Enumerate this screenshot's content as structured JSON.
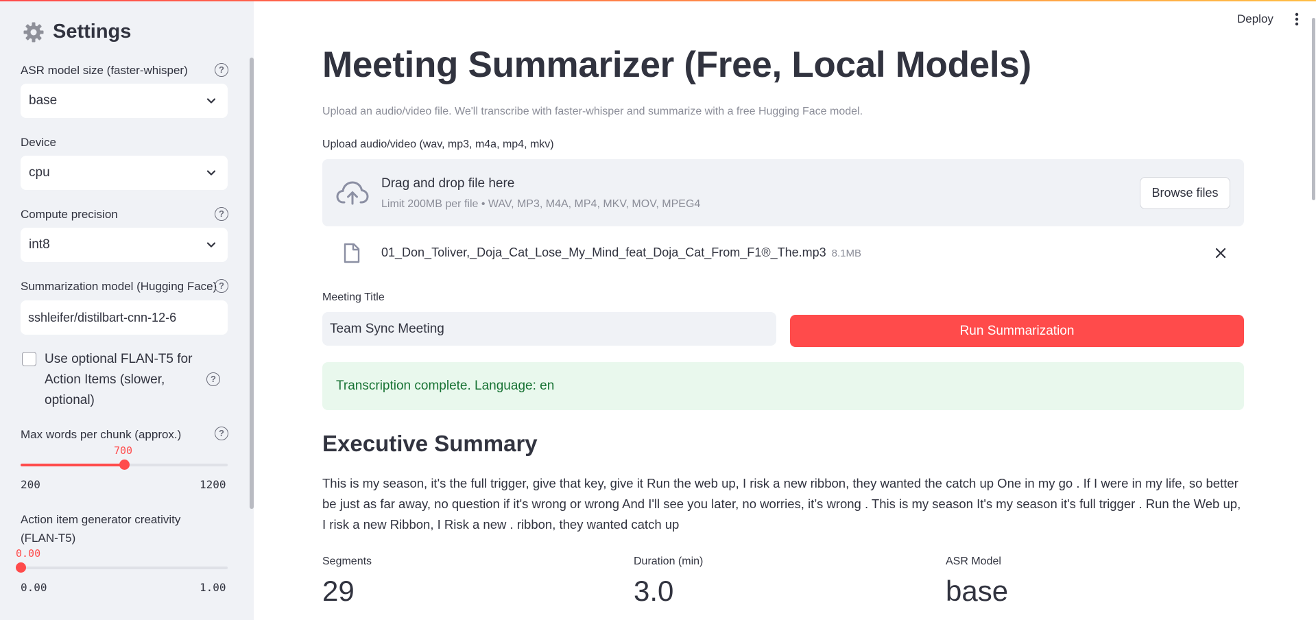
{
  "header": {
    "deploy_label": "Deploy",
    "menu_icon": "kebab-menu-icon"
  },
  "sidebar": {
    "title": "Settings",
    "asr_model": {
      "label": "ASR model size (faster-whisper)",
      "value": "base"
    },
    "device": {
      "label": "Device",
      "value": "cpu"
    },
    "precision": {
      "label": "Compute precision",
      "value": "int8"
    },
    "summ_model": {
      "label": "Summarization model (Hugging Face)",
      "value": "sshleifer/distilbart-cnn-12-6"
    },
    "flan_checkbox": {
      "label": "Use optional FLAN-T5 for Action Items (slower, optional)",
      "checked": false
    },
    "max_words": {
      "label": "Max words per chunk (approx.)",
      "value": "700",
      "min": "200",
      "max": "1200",
      "fraction": 0.5
    },
    "creativity": {
      "label": "Action item generator creativity (FLAN-T5)",
      "value": "0.00",
      "min": "0.00",
      "max": "1.00",
      "fraction": 0.0
    }
  },
  "main": {
    "title": "Meeting Summarizer (Free, Local Models)",
    "caption": "Upload an audio/video file. We'll transcribe with faster-whisper and summarize with a free Hugging Face model.",
    "uploader": {
      "label": "Upload audio/video (wav, mp3, m4a, mp4, mkv)",
      "drag_text": "Drag and drop file here",
      "limit_text": "Limit 200MB per file • WAV, MP3, M4A, MP4, MKV, MOV, MPEG4",
      "browse_label": "Browse files"
    },
    "file": {
      "name": "01_Don_Toliver,_Doja_Cat_Lose_My_Mind_feat_Doja_Cat_From_F1®_The.mp3",
      "size": "8.1MB"
    },
    "meeting_title": {
      "label": "Meeting Title",
      "value": "Team Sync Meeting"
    },
    "run_button": "Run Summarization",
    "success_message": "Transcription complete. Language: en",
    "summary_heading": "Executive Summary",
    "summary_text": "This is my season, it's the full trigger, give that key, give it Run the web up, I risk a new ribbon, they wanted the catch up One in my go . If I were in my life, so better be just as far away, no question if it's wrong or wrong And I'll see you later, no worries, it’s wrong . This is my season It's my season it's full trigger . Run the Web up, I risk a new Ribbon, I Risk a new . ribbon, they wanted catch up",
    "metrics": [
      {
        "label": "Segments",
        "value": "29"
      },
      {
        "label": "Duration (min)",
        "value": "3.0"
      },
      {
        "label": "ASR Model",
        "value": "base"
      }
    ]
  },
  "colors": {
    "accent": "#ff4b4b",
    "sidebar_bg": "#f0f2f6",
    "success_bg": "#e9f8ed",
    "success_text": "#177233"
  }
}
